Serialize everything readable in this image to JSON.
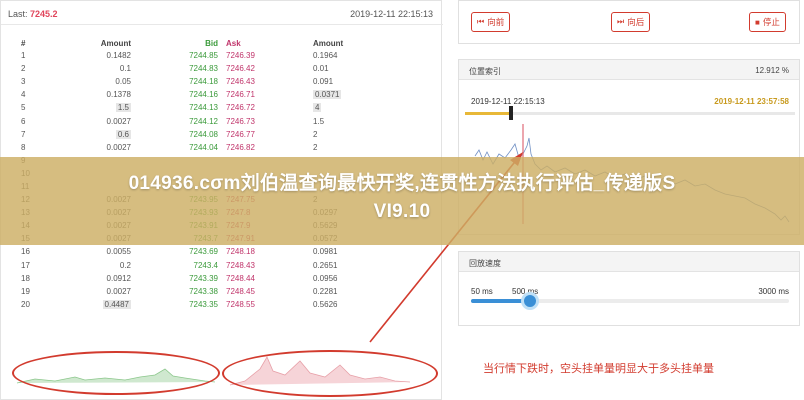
{
  "header": {
    "last_label": "Last:",
    "last_value": "7245.2",
    "timestamp": "2019-12-11 22:15:13"
  },
  "orderbook": {
    "columns": [
      "#",
      "Amount",
      "Bid",
      "Ask",
      "Amount"
    ],
    "rows": [
      {
        "n": "1",
        "amt": "0.1482",
        "bid": "7244.85",
        "ask": "7246.39",
        "amt2": "0.1964"
      },
      {
        "n": "2",
        "amt": "0.1",
        "bid": "7244.83",
        "ask": "7246.42",
        "amt2": "0.01"
      },
      {
        "n": "3",
        "amt": "0.05",
        "bid": "7244.18",
        "ask": "7246.43",
        "amt2": "0.091"
      },
      {
        "n": "4",
        "amt": "0.1378",
        "bid": "7244.16",
        "ask": "7246.71",
        "amt2": "0.0371"
      },
      {
        "n": "5",
        "amt": "1.5",
        "bid": "7244.13",
        "ask": "7246.72",
        "amt2": "4"
      },
      {
        "n": "6",
        "amt": "0.0027",
        "bid": "7244.12",
        "ask": "7246.73",
        "amt2": "1.5"
      },
      {
        "n": "7",
        "amt": "0.6",
        "bid": "7244.08",
        "ask": "7246.77",
        "amt2": "2"
      },
      {
        "n": "8",
        "amt": "0.0027",
        "bid": "7244.04",
        "ask": "7246.82",
        "amt2": "2"
      },
      {
        "n": "9",
        "amt": "",
        "bid": "",
        "ask": "",
        "amt2": ""
      },
      {
        "n": "10",
        "amt": "",
        "bid": "",
        "ask": "",
        "amt2": ""
      },
      {
        "n": "11",
        "amt": "",
        "bid": "",
        "ask": "",
        "amt2": ""
      },
      {
        "n": "12",
        "amt": "0.0027",
        "bid": "7243.95",
        "ask": "7247.75",
        "amt2": "2"
      },
      {
        "n": "13",
        "amt": "0.0027",
        "bid": "7243.93",
        "ask": "7247.8",
        "amt2": "0.0297"
      },
      {
        "n": "14",
        "amt": "0.0027",
        "bid": "7243.91",
        "ask": "7247.9",
        "amt2": "0.5629"
      },
      {
        "n": "15",
        "amt": "0.0027",
        "bid": "7243.7",
        "ask": "7247.91",
        "amt2": "0.0572"
      },
      {
        "n": "16",
        "amt": "0.0055",
        "bid": "7243.69",
        "ask": "7248.18",
        "amt2": "0.0981"
      },
      {
        "n": "17",
        "amt": "0.2",
        "bid": "7243.4",
        "ask": "7248.43",
        "amt2": "0.2651"
      },
      {
        "n": "18",
        "amt": "0.0912",
        "bid": "7243.39",
        "ask": "7248.44",
        "amt2": "0.0956"
      },
      {
        "n": "19",
        "amt": "0.0027",
        "bid": "7243.38",
        "ask": "7248.45",
        "amt2": "0.2281"
      },
      {
        "n": "20",
        "amt": "0.4487",
        "bid": "7243.35",
        "ask": "7248.55",
        "amt2": "0.5626"
      }
    ]
  },
  "controls": {
    "prev_label": "向前",
    "next_label": "向后",
    "stop_label": "停止"
  },
  "position": {
    "title": "位置索引",
    "percent": "12.912 %",
    "start_time": "2019-12-11 22:15:13",
    "end_time": "2019-12-11 23:57:58"
  },
  "speed": {
    "title": "回放速度",
    "min_label": "50 ms",
    "value_label": "500 ms",
    "max_label": "3000 ms"
  },
  "banner": {
    "line1": "014936.cσm刘伯温查询最快开奖,连贯性方法执行评估_传递版S",
    "line2": "VI9.10"
  },
  "annotation": {
    "caption": "当行情下跌时，空头挂单量明显大于多头挂单量"
  },
  "colors": {
    "bid": "#3a9a3a",
    "ask": "#c0346a",
    "accent": "#d23b2e",
    "slider": "#3a8fd6"
  }
}
